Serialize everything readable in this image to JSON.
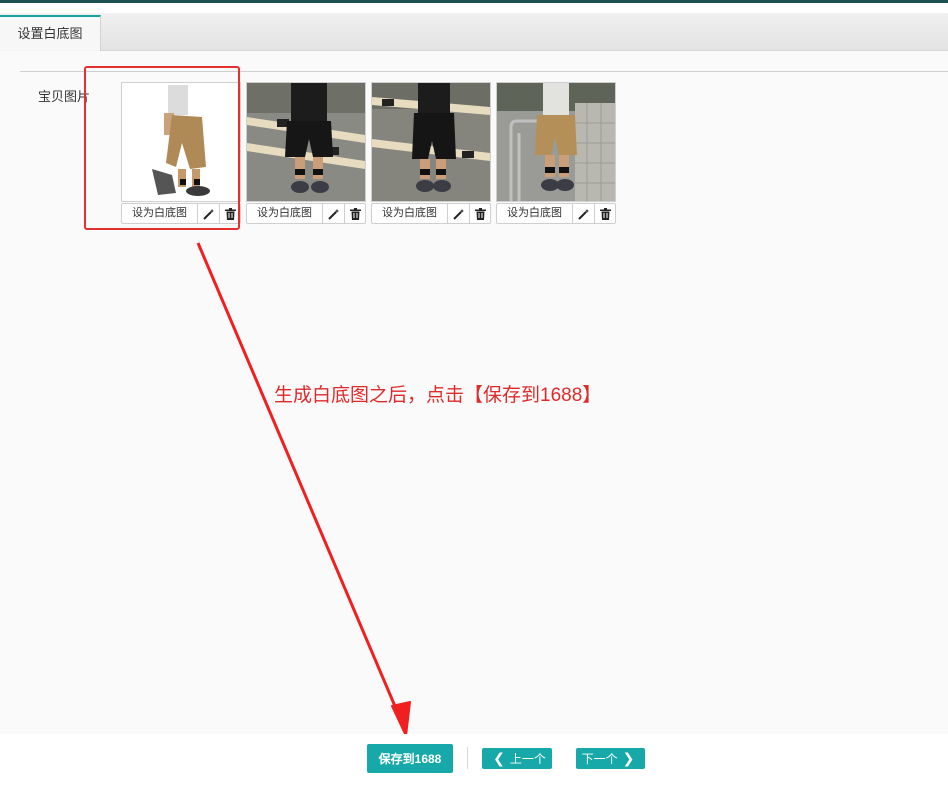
{
  "tab": {
    "label": "设置白底图"
  },
  "field": {
    "label": "宝贝图片"
  },
  "images": [
    {
      "set_label": "设为白底图",
      "kind": "white-background-product"
    },
    {
      "set_label": "设为白底图",
      "kind": "model-street-photo"
    },
    {
      "set_label": "设为白底图",
      "kind": "model-street-photo"
    },
    {
      "set_label": "设为白底图",
      "kind": "model-street-photo"
    }
  ],
  "annotation": {
    "text": "生成白底图之后，点击【保存到1688】",
    "color": "#e02a2a"
  },
  "footer": {
    "save_label": "保存到1688",
    "prev_label": "上一个",
    "next_label": "下一个"
  },
  "colors": {
    "accent": "#17a9a9",
    "annotation_red": "#e53030"
  },
  "icons": [
    "magic-wand-icon",
    "trash-icon",
    "chevron-left-icon",
    "chevron-right-icon"
  ]
}
